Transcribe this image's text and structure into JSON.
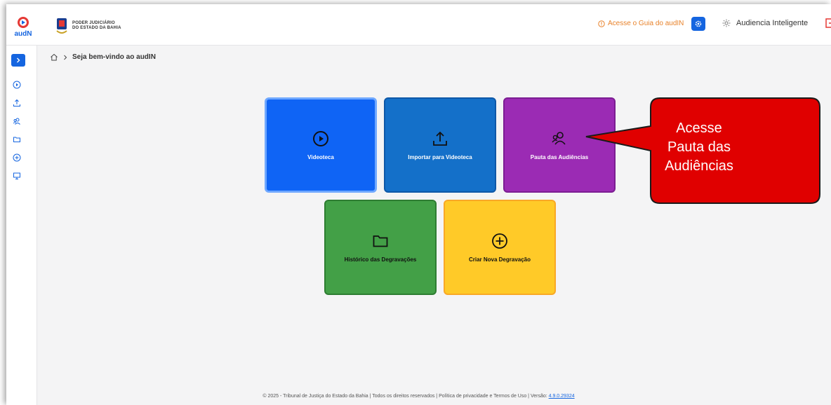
{
  "header": {
    "app_logo_text": "audN",
    "brand_line1": "PODER JUDICIÁRIO",
    "brand_line2": "DO ESTADO DA BAHIA",
    "guide_link": "Acesse o Guia do audIN",
    "user_name": "Audiencia Inteligente"
  },
  "sidebar": {
    "items": [
      {
        "icon": "play-circle-icon"
      },
      {
        "icon": "upload-icon"
      },
      {
        "icon": "people-icon"
      },
      {
        "icon": "folder-icon"
      },
      {
        "icon": "plus-circle-icon"
      },
      {
        "icon": "monitor-icon"
      }
    ]
  },
  "breadcrumb": {
    "current": "Seja bem-vindo ao audIN"
  },
  "tiles": [
    {
      "label": "Videoteca",
      "icon": "play-circle-icon",
      "color": "#0f64f5"
    },
    {
      "label": "Importar para Videoteca",
      "icon": "upload-icon",
      "color": "#1470c9"
    },
    {
      "label": "Pauta das Audiências",
      "icon": "people-icon",
      "color": "#9b2bb4"
    },
    {
      "label": "Histórico das Degravações",
      "icon": "folder-icon",
      "color": "#43a047"
    },
    {
      "label": "Criar Nova Degravação",
      "icon": "plus-circle-icon",
      "color": "#ffca28"
    }
  ],
  "callout": {
    "line1": "Acesse",
    "line2": "Pauta das",
    "line3": "Audiências",
    "color": "#e00000"
  },
  "footer": {
    "text": "© 2025 - Tribunal de Justiça do Estado da Bahia | Todos os direitos reservados | Política de privacidade e Termos de Uso | Versão: ",
    "version": "4.9.0.29324"
  }
}
